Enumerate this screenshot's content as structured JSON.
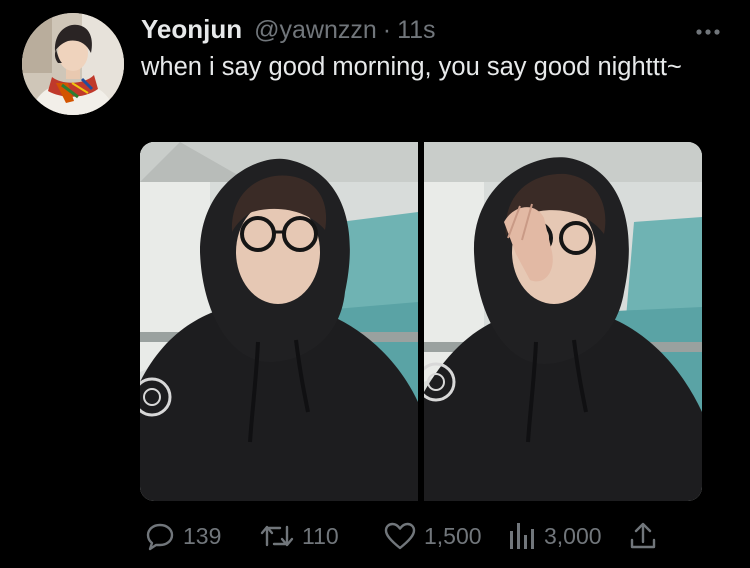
{
  "tweet": {
    "display_name": "Yeonjun",
    "handle": "@yawnzzn",
    "separator": "·",
    "time": "11s",
    "text": "when i say good morning, you say good nighttt~"
  },
  "media": {
    "photo_count": 2
  },
  "actions": {
    "replies": "139",
    "retweets": "110",
    "likes": "1,500",
    "views": "3,000"
  },
  "icons": {
    "more": "more-horizontal-icon",
    "reply": "speech-bubble-icon",
    "retweet": "retweet-arrows-icon",
    "like": "heart-icon",
    "views": "bar-chart-icon",
    "share": "share-upload-icon"
  },
  "colors": {
    "background": "#000000",
    "primary_text": "#e7e9ea",
    "secondary_text": "#71767b"
  }
}
